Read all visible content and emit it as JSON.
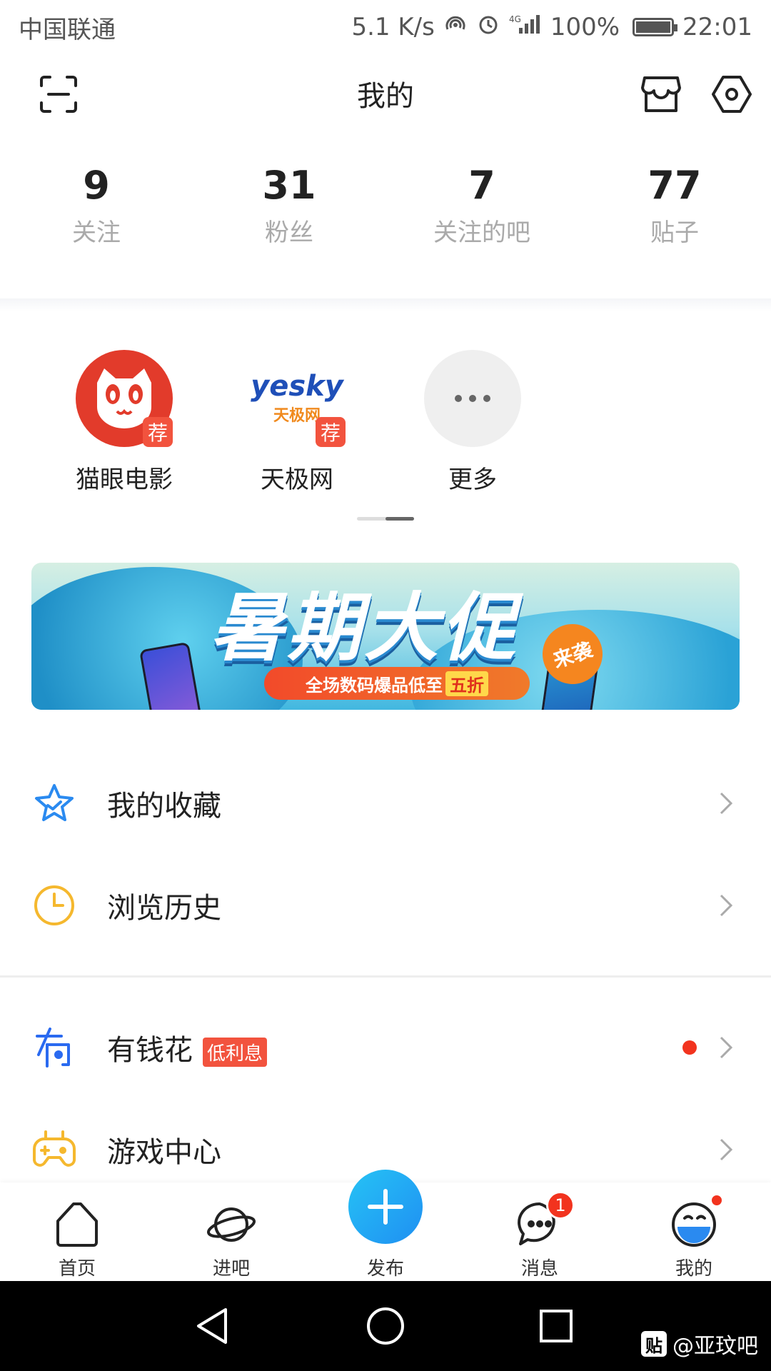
{
  "status_bar": {
    "carrier": "中国联通",
    "speed": "5.1 K/s",
    "battery": "100%",
    "time": "22:01"
  },
  "header": {
    "title": "我的"
  },
  "stats": [
    {
      "value": "9",
      "label": "关注"
    },
    {
      "value": "31",
      "label": "粉丝"
    },
    {
      "value": "7",
      "label": "关注的吧"
    },
    {
      "value": "77",
      "label": "贴子"
    }
  ],
  "apps": [
    {
      "label": "猫眼电影",
      "badge": "荐",
      "icon": "maoyan-cat-icon",
      "color": "#e23b2b"
    },
    {
      "label": "天极网",
      "badge": "荐",
      "icon": "yesky-logo-icon",
      "logo_text": "yesky",
      "logo_sub": "天极网"
    },
    {
      "label": "更多",
      "icon": "more-dots-icon"
    }
  ],
  "banner": {
    "title": "暑期大促",
    "badge": "来袭",
    "subtitle_prefix": "全场数码爆品低至",
    "subtitle_highlight": "五折"
  },
  "menu": [
    {
      "label": "我的收藏",
      "icon": "star-icon",
      "color": "#2a8af0"
    },
    {
      "label": "浏览历史",
      "icon": "clock-icon",
      "color": "#f5b82e"
    },
    {
      "label": "有钱花",
      "tag": "低利息",
      "icon": "money-icon",
      "color": "#2a6af0"
    },
    {
      "label": "游戏中心",
      "icon": "gamepad-icon",
      "color": "#f5b82e"
    }
  ],
  "bottom_nav": [
    {
      "label": "首页",
      "icon": "home-icon"
    },
    {
      "label": "进吧",
      "icon": "planet-icon"
    },
    {
      "label": "发布",
      "icon": "plus-icon"
    },
    {
      "label": "消息",
      "icon": "chat-icon",
      "badge": "1"
    },
    {
      "label": "我的",
      "icon": "profile-face-icon"
    }
  ],
  "watermark": {
    "icon_text": "贴",
    "text": "@亚玟吧"
  },
  "colors": {
    "accent": "#26a0f0",
    "badge_red": "#f2331e",
    "tag_red": "#f2533e"
  }
}
